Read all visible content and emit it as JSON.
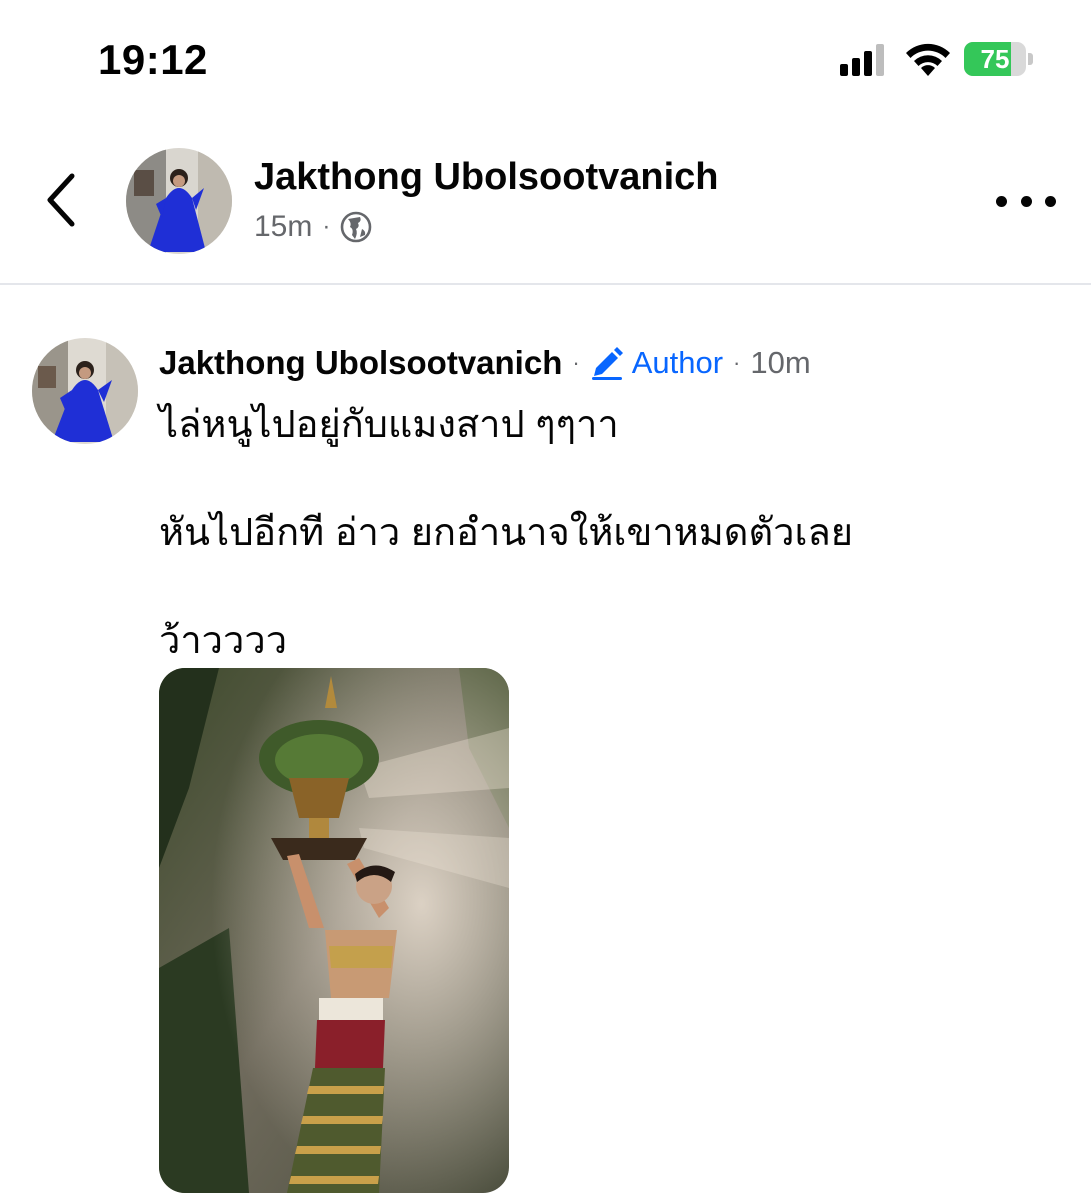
{
  "status_bar": {
    "time": "19:12",
    "battery_level": "75",
    "battery_fraction": 0.75,
    "icons": [
      "cellular-signal-icon",
      "wifi-icon",
      "battery-charging-icon"
    ]
  },
  "header": {
    "back_icon": "chevron-left-icon",
    "author_name": "Jakthong Ubolsootvanich",
    "time_ago": "15m",
    "audience_icon": "globe-icon",
    "more_icon": "more-horizontal-icon"
  },
  "comment": {
    "author_name": "Jakthong Ubolsootvanich",
    "badge_label": "Author",
    "badge_icon": "pencil-icon",
    "time_ago": "10m",
    "paragraphs": [
      "ไล่หนูไปอยู่กับแมงสาป ๆๆาา",
      "หันไปอีกที อ่าว ยกอำนาจให้เขาหมดตัวเลย",
      "ว้าวววว"
    ]
  },
  "colors": {
    "link_blue": "#0866ff",
    "meta_gray": "#65676b",
    "battery_green": "#34c759",
    "divider": "#e4e6eb"
  }
}
